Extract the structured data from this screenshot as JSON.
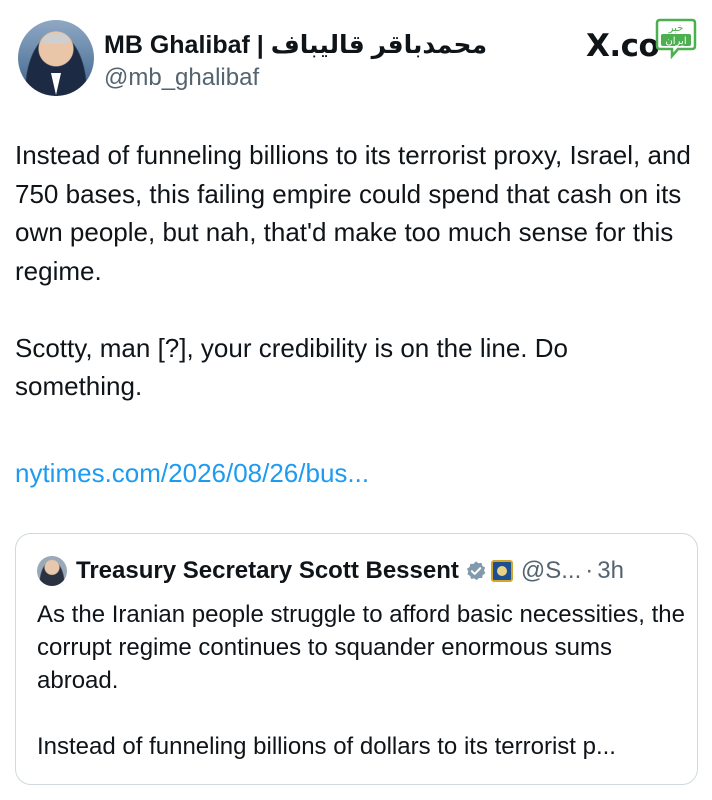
{
  "tweet": {
    "display_name": "MB Ghalibaf | محمدباقر قالیباف",
    "handle": "@mb_ghalibaf",
    "avatar_icon": "profile-photo",
    "paragraphs": [
      "Instead of funneling billions to its terrorist proxy, Israel, and 750 bases, this failing empire could spend that cash on its own people, but nah, that'd make too much sense for this regime.",
      "Scotty, man [?], your credibility is on the line. Do something."
    ],
    "link": "nytimes.com/2026/08/26/bus..."
  },
  "watermark": {
    "x_logo_text": "X.co",
    "badge_text_top": "خبر",
    "badge_text_bottom": "ایران",
    "badge_color": "#4caf50"
  },
  "quoted_tweet": {
    "display_name": "Treasury Secretary Scott Bessent",
    "handle": "@S...",
    "separator": "·",
    "time": "3h",
    "verified_icon": "gray-verified-badge-icon",
    "affiliation_icon": "treasury-seal-icon",
    "paragraphs": [
      "As the Iranian people struggle to afford basic necessities, the corrupt regime continues to squander enormous sums abroad.",
      "Instead of funneling billions of dollars to its terrorist p..."
    ]
  },
  "colors": {
    "text": "#0f1419",
    "secondary": "#536471",
    "link": "#1d9bf0",
    "border": "#cfd9de",
    "verified_gray": "#829aab"
  }
}
